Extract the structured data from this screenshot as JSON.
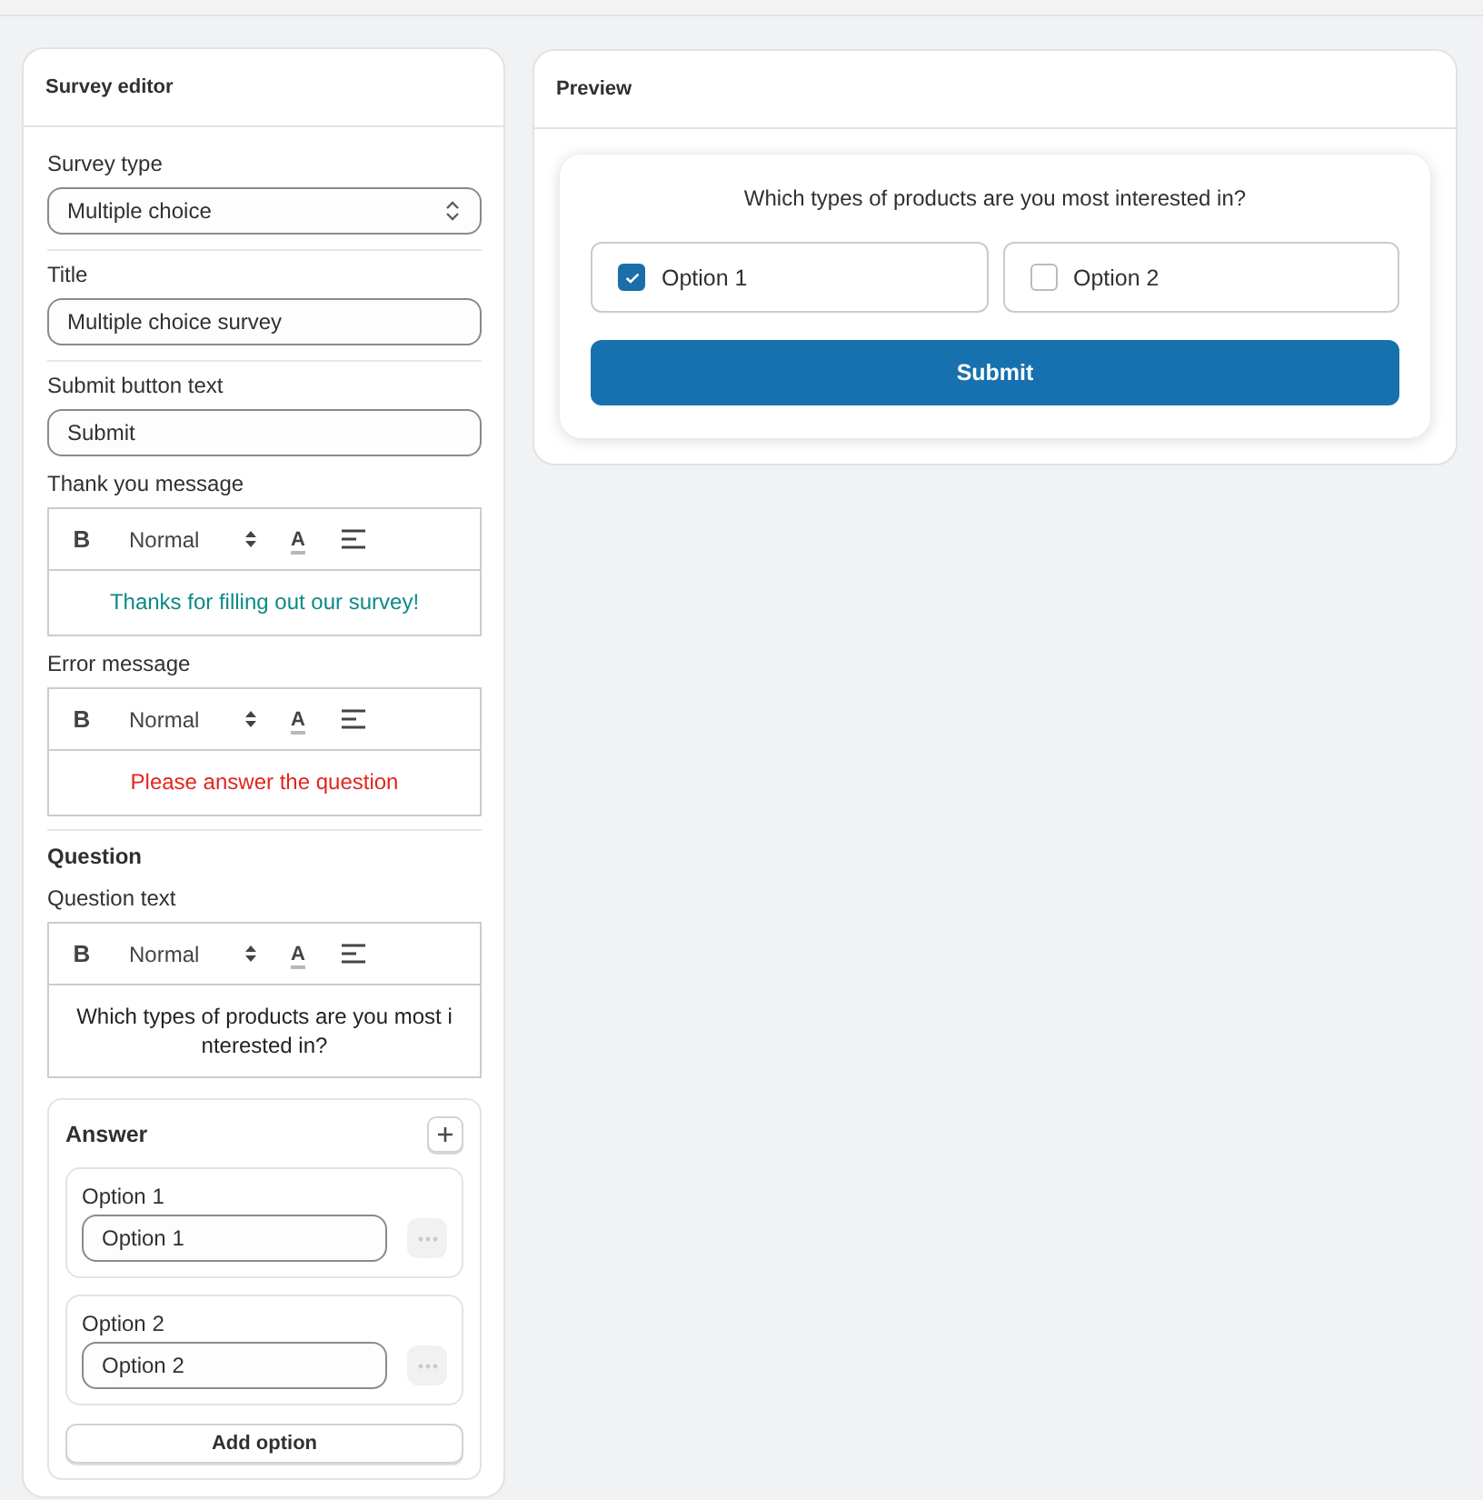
{
  "editor": {
    "title": "Survey editor",
    "survey_type": {
      "label": "Survey type",
      "value": "Multiple choice"
    },
    "fields": [
      {
        "label": "Title",
        "value": "Multiple choice survey"
      },
      {
        "label": "Submit button text",
        "value": "Submit"
      }
    ],
    "messages": [
      {
        "label": "Thank you message",
        "toolbar": {
          "bold": "B",
          "format": "Normal",
          "text_color": "A"
        },
        "text": "Thanks for filling out our survey!",
        "color": "#0b8a86"
      },
      {
        "label": "Error message",
        "toolbar": {
          "bold": "B",
          "format": "Normal",
          "text_color": "A"
        },
        "text": "Please answer the question",
        "color": "#e3251d"
      }
    ],
    "question": {
      "heading": "Question",
      "label": "Question text",
      "toolbar": {
        "bold": "B",
        "format": "Normal",
        "text_color": "A"
      },
      "text": "Which types of products are you most interested in?"
    },
    "answer": {
      "title": "Answer",
      "options": [
        {
          "label": "Option 1",
          "value": "Option 1"
        },
        {
          "label": "Option 2",
          "value": "Option 2"
        }
      ],
      "add_button": "Add option"
    }
  },
  "preview": {
    "title": "Preview",
    "question": "Which types of products are you most interested in?",
    "options": [
      {
        "label": "Option 1",
        "checked": true
      },
      {
        "label": "Option 2",
        "checked": false
      }
    ],
    "submit": "Submit"
  }
}
